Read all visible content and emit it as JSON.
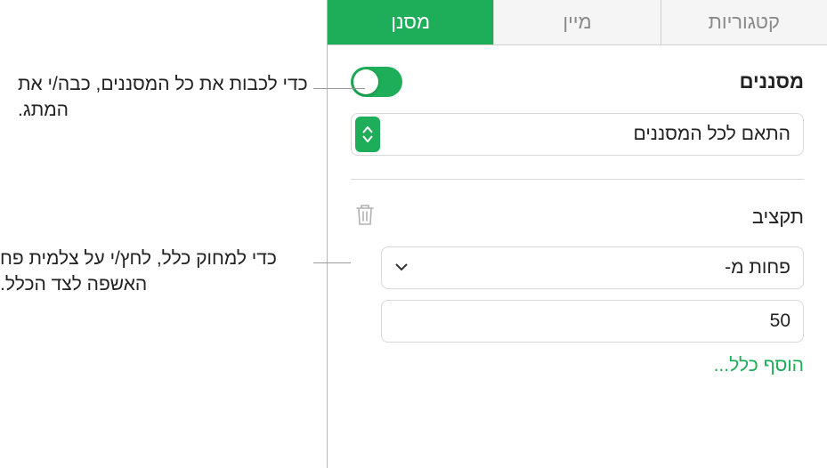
{
  "tabs": {
    "categories": "קטגוריות",
    "sort": "מיין",
    "filter": "מסנן"
  },
  "filters": {
    "title": "מסננים",
    "match_label": "התאם לכל המסננים"
  },
  "rule": {
    "title": "תקציב",
    "condition": "פחות מ-",
    "value": "50"
  },
  "add_rule": "הוסף כלל...",
  "callouts": {
    "toggle": "כדי לכבות את כל המסננים, כבה/י את המתג.",
    "trash": "כדי למחוק כלל, לחץ/י על צלמית פח האשפה לצד הכלל."
  }
}
